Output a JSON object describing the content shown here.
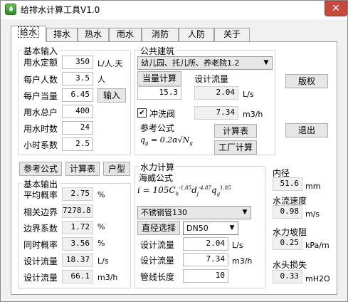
{
  "window": {
    "title": "给排水计算工具V1.0",
    "close_symbol": "✕"
  },
  "tabs": [
    "给水",
    "排水",
    "热水",
    "雨水",
    "消防",
    "人防",
    "关于"
  ],
  "basic_input": {
    "title": "基本输入",
    "rows": [
      {
        "label": "用水定额",
        "value": "350",
        "unit": "L/人.天"
      },
      {
        "label": "每户人数",
        "value": "3.5",
        "unit": "人"
      },
      {
        "label": "每户当量",
        "value": "6.45",
        "unit": ""
      },
      {
        "label": "用水总户",
        "value": "400",
        "unit": ""
      },
      {
        "label": "用水时数",
        "value": "24",
        "unit": ""
      },
      {
        "label": "小时系数",
        "value": "2.5",
        "unit": ""
      }
    ],
    "input_button": "输入"
  },
  "public_building": {
    "title": "公共建筑",
    "select": "幼儿园、托儿所、养老院1.2",
    "equiv_calc_button": "当量计算",
    "design_flow_label": "设计流量",
    "equiv_value": "15.3",
    "design_flow_value": "2.04",
    "design_flow_unit": "L/s",
    "flush_valve_label": "冲洗阀",
    "flush_valve_checked": true,
    "flush_value": "7.34",
    "flush_unit": "m3/h",
    "ref_formula_label": "参考公式",
    "calc_table_button": "计算表",
    "factory_calc_button": "工厂计算"
  },
  "right_buttons": {
    "copyright": "版权",
    "exit": "退出"
  },
  "middle_buttons": {
    "ref_formula": "参考公式",
    "calc_table": "计算表",
    "unit_type": "户型"
  },
  "basic_output": {
    "title": "基本输出",
    "rows": [
      {
        "label": "平均概率",
        "value": "2.75",
        "unit": "%"
      },
      {
        "label": "相关边界",
        "value": "7278.8",
        "unit": ""
      },
      {
        "label": "边界系数",
        "value": "1.72",
        "unit": "%"
      },
      {
        "label": "同时概率",
        "value": "3.56",
        "unit": "%"
      },
      {
        "label": "设计流量",
        "value": "18.37",
        "unit": "L/s"
      },
      {
        "label": "设计流量",
        "value": "66.1",
        "unit": "m3/h"
      }
    ]
  },
  "hydraulic": {
    "title": "水力计算",
    "hazen_label": "海威公式",
    "pipe_select": "不锈钢管130",
    "diameter_button": "直径选择",
    "dn_select": "DN50",
    "rows": [
      {
        "label": "设计流量",
        "value": "2.04",
        "unit": "L/s"
      },
      {
        "label": "设计流量",
        "value": "7.34",
        "unit": "m3/h"
      },
      {
        "label": "管线长度",
        "value": "10",
        "unit": ""
      }
    ]
  },
  "results": [
    {
      "label": "内径",
      "value": "51.6",
      "unit": "mm"
    },
    {
      "label": "水流速度",
      "value": "0.98",
      "unit": "m/s"
    },
    {
      "label": "水力坡阻",
      "value": "0.25",
      "unit": "kPa/m"
    },
    {
      "label": "水头损失",
      "value": "0.33",
      "unit": "mH2O"
    }
  ]
}
